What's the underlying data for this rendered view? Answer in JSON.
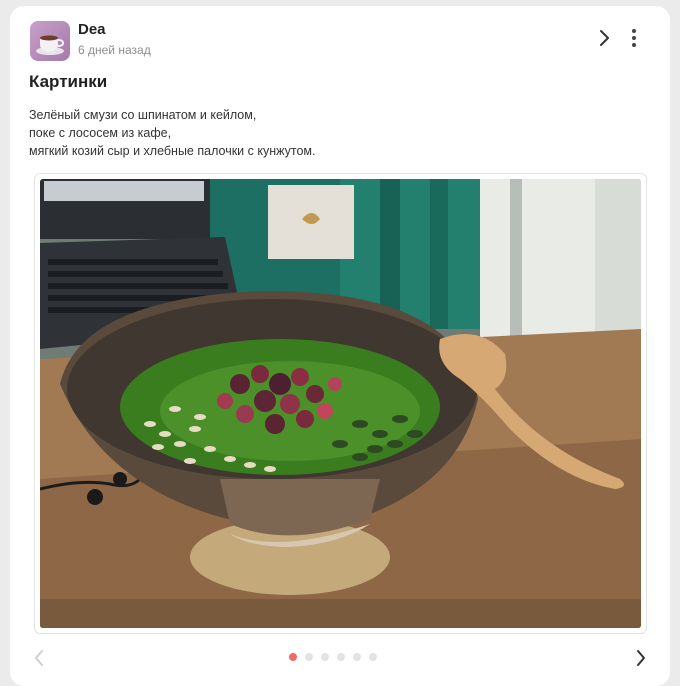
{
  "post": {
    "author": "Dea",
    "timestamp": "6 дней назад",
    "title": "Картинки",
    "description_lines": [
      "Зелёный смузи со шпинатом и кейлом,",
      "поке с лососем из кафе,",
      "мягкий козий сыр и хлебные палочки с кунжутом."
    ]
  },
  "header": {
    "share_icon": "chevron-right-icon",
    "menu_icon": "more-vertical-icon"
  },
  "carousel": {
    "slide_count": 6,
    "active_index": 0,
    "prev_icon": "chevron-left-icon",
    "next_icon": "chevron-right-icon"
  },
  "colors": {
    "accent": "#f26b63",
    "dot_inactive": "#e3e3e3",
    "background": "#ebebeb",
    "card": "#ffffff"
  }
}
